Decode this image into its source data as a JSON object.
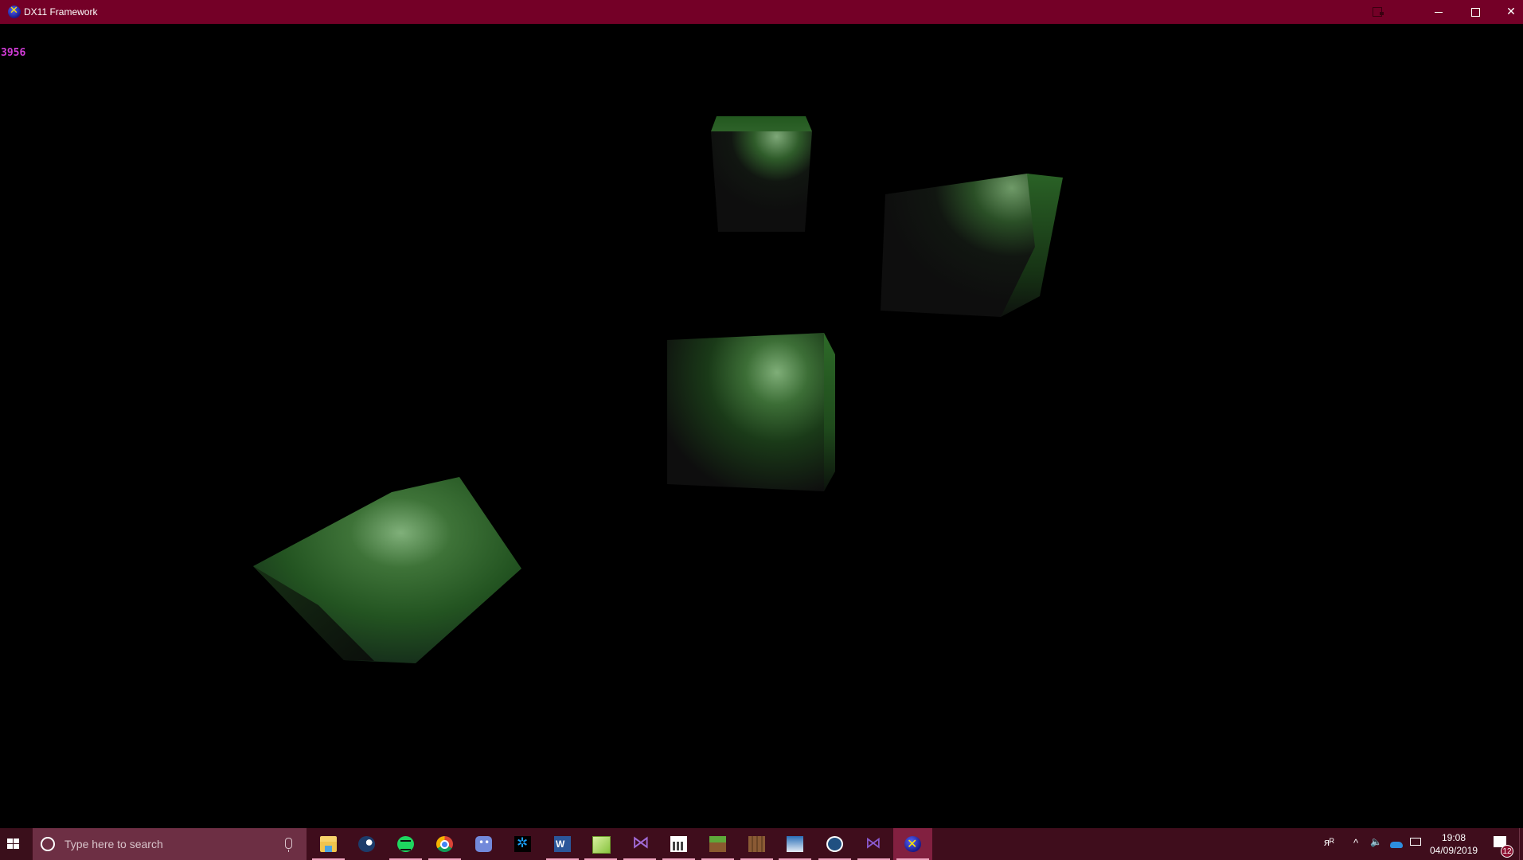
{
  "window": {
    "title": "DX11 Framework",
    "app_icon": "directx-x-icon",
    "controls": {
      "minimize": "minimize-icon",
      "maximize": "maximize-icon",
      "close": "close-icon",
      "close_glyph": "✕"
    },
    "title_bar_color": "#740027"
  },
  "viewport": {
    "fps_counter": "3956",
    "fps_color": "#d23cd8",
    "background": "#000000",
    "scene": {
      "object_type": "cube",
      "object_count": 4,
      "material_color": "#2f6a2a",
      "specular_color": "#7fb07a",
      "objects": [
        {
          "id": "cube-top",
          "description": "upright cube, top face lit"
        },
        {
          "id": "cube-right",
          "description": "tilted cube, right edge lit"
        },
        {
          "id": "cube-center",
          "description": "cube facing camera, specular highlight upper right"
        },
        {
          "id": "cube-bottom-left",
          "description": "rotated cube, specular highlight on top face"
        }
      ]
    }
  },
  "taskbar": {
    "start_icon": "windows-logo-icon",
    "search": {
      "placeholder": "Type here to search",
      "icon": "cortana-circle-icon",
      "mic_icon": "microphone-icon"
    },
    "apps": [
      {
        "name": "File Explorer",
        "icon": "folder-icon",
        "running": true,
        "active": false
      },
      {
        "name": "Steam",
        "icon": "steam-icon",
        "running": false,
        "active": false
      },
      {
        "name": "Spotify",
        "icon": "spotify-icon",
        "running": true,
        "active": false
      },
      {
        "name": "Google Chrome",
        "icon": "chrome-icon",
        "running": true,
        "active": false
      },
      {
        "name": "Discord",
        "icon": "discord-icon",
        "running": false,
        "active": false
      },
      {
        "name": "Battle.net",
        "icon": "battlenet-icon",
        "running": false,
        "active": false
      },
      {
        "name": "Microsoft Word",
        "icon": "word-icon",
        "running": true,
        "active": false
      },
      {
        "name": "Notepad++",
        "icon": "notepadpp-icon",
        "running": true,
        "active": false
      },
      {
        "name": "Visual Studio",
        "icon": "visual-studio-icon",
        "running": true,
        "active": false
      },
      {
        "name": "Calculator",
        "icon": "calculator-icon",
        "running": true,
        "active": false
      },
      {
        "name": "Minecraft",
        "icon": "minecraft-grass-icon",
        "running": true,
        "active": false
      },
      {
        "name": "Minecraft Launcher",
        "icon": "crafting-table-icon",
        "running": true,
        "active": false
      },
      {
        "name": "Paint",
        "icon": "paint-icon",
        "running": true,
        "active": false
      },
      {
        "name": "Sourcetree",
        "icon": "sourcetree-icon",
        "running": true,
        "active": false
      },
      {
        "name": "Visual Studio 2019",
        "icon": "visual-studio-2019-icon",
        "running": true,
        "active": false
      },
      {
        "name": "DX11 Framework",
        "icon": "directx-x-icon",
        "running": true,
        "active": true
      }
    ],
    "tray": {
      "people_icon": "people-icon",
      "overflow_glyph": "^",
      "volume_glyph": "🔈",
      "onedrive_icon": "onedrive-cloud-icon",
      "network_icon": "network-icon",
      "time": "19:08",
      "date": "04/09/2019",
      "notification_count": "12"
    },
    "colors": {
      "background": "#3f0d1c",
      "search_bg": "#6d2f44",
      "active_app": "#822040",
      "running_indicator": "#f0a6c0"
    }
  }
}
